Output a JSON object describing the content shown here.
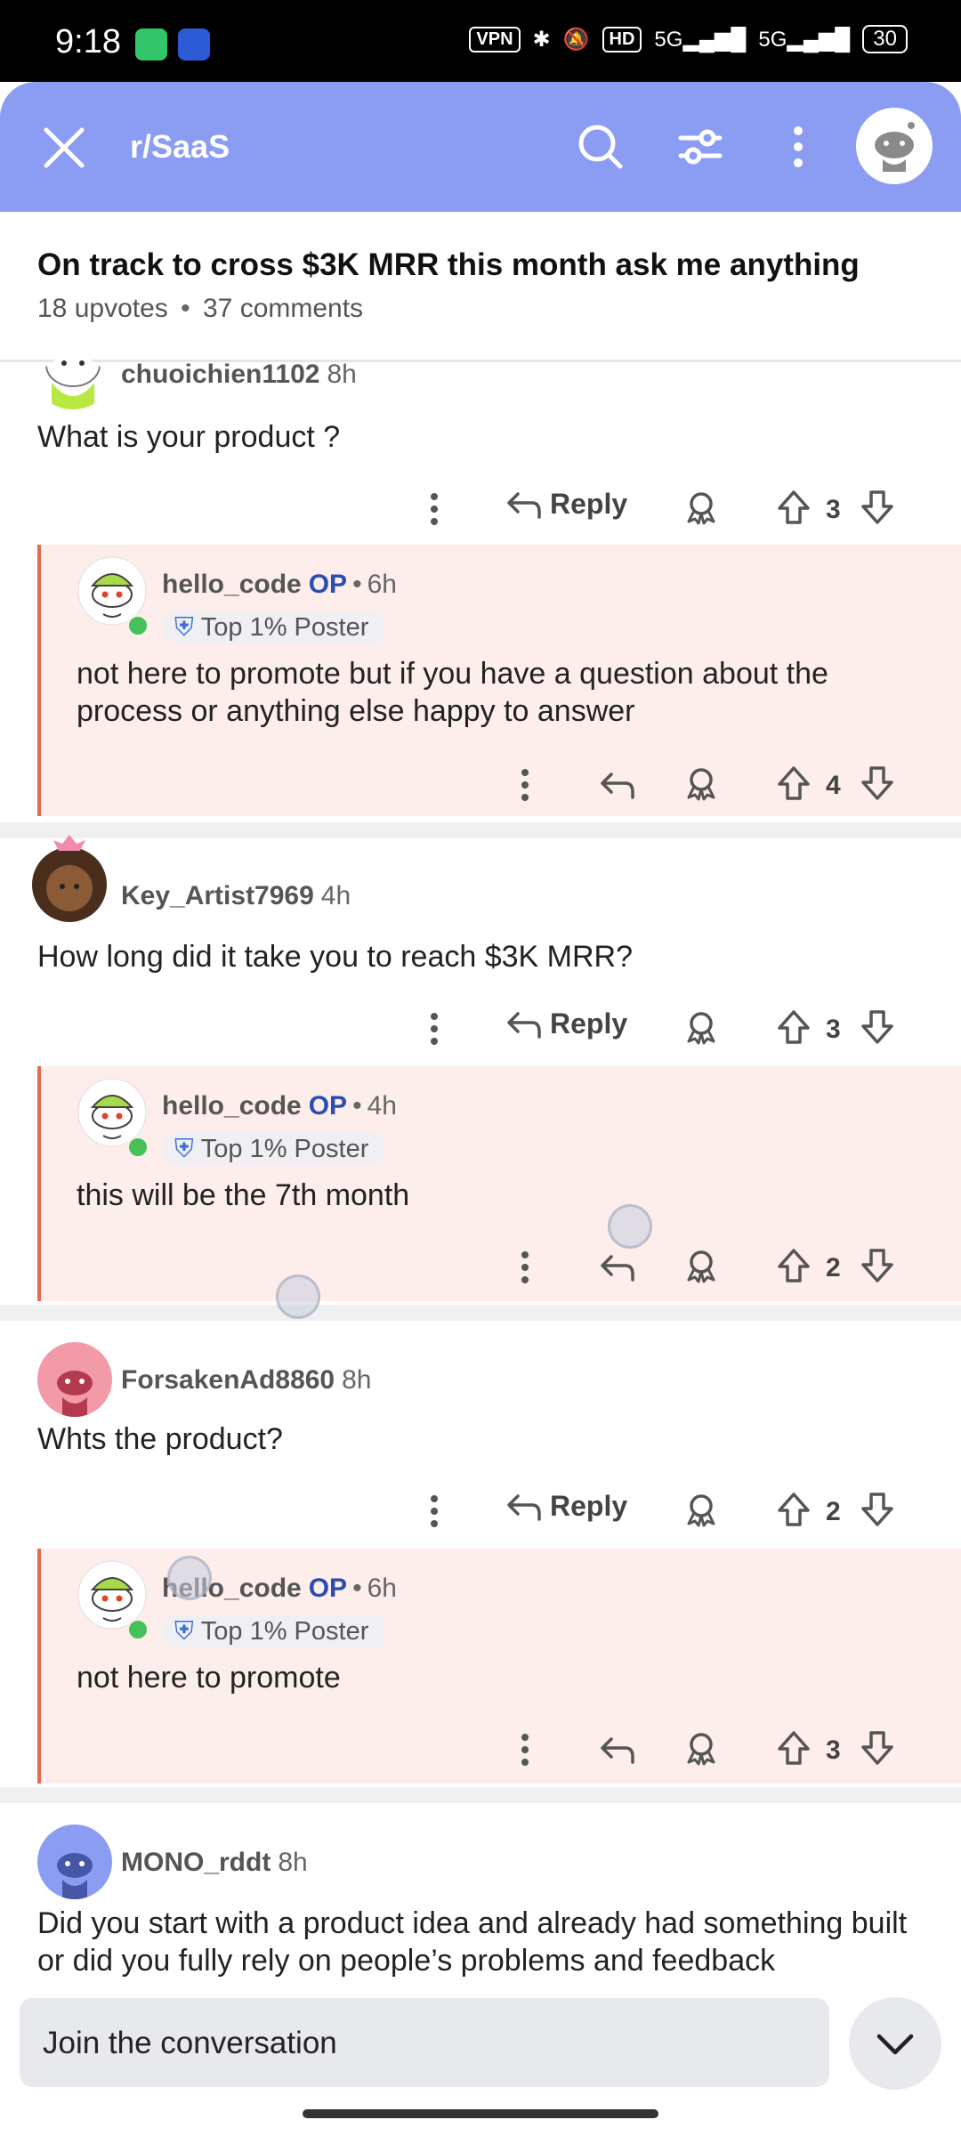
{
  "status_bar": {
    "time": "9:18",
    "vpn": "VPN",
    "hd": "HD",
    "net1": "5G",
    "net2": "5G",
    "battery": "30"
  },
  "header": {
    "subreddit": "r/SaaS"
  },
  "post": {
    "title": "On track to cross $3K MRR this month ask me anything",
    "upvotes": "18 upvotes",
    "comments": "37 comments"
  },
  "labels": {
    "reply": "Reply",
    "op": "OP",
    "flair": "Top 1% Poster",
    "sep": "•"
  },
  "threads": [
    {
      "user": "chuoichien1102",
      "time": "8h",
      "body": "What is your product ?",
      "votes": "3",
      "reply": {
        "user": "hello_code",
        "time": "6h",
        "body": "not here to promote but if you have a question about the process or anything else happy to answer",
        "votes": "4"
      }
    },
    {
      "user": "Key_Artist7969",
      "time": "4h",
      "body": "How long did it take you to reach $3K MRR?",
      "votes": "3",
      "reply": {
        "user": "hello_code",
        "time": "4h",
        "body": "this will be the 7th month",
        "votes": "2"
      }
    },
    {
      "user": "ForsakenAd8860",
      "time": "8h",
      "body": "Whts the product?",
      "votes": "2",
      "reply": {
        "user": "hello_code",
        "time": "6h",
        "body": "not here to promote",
        "votes": "3"
      }
    },
    {
      "user": "MONO_rddt",
      "time": "8h",
      "body": "Did you start with a product idea and already had something built or did you fully rely on people’s problems and feedback"
    }
  ],
  "composer": {
    "placeholder": "Join the conversation"
  },
  "colors": {
    "header": "#8b9cf3",
    "reply_bg": "#fdeeeb",
    "reply_border": "#e46a50",
    "op": "#2a4db3"
  },
  "icons": [
    "close-icon",
    "search-icon",
    "filter-icon",
    "more-vert-icon",
    "award-icon",
    "upvote-icon",
    "downvote-icon",
    "reply-arrow-icon",
    "chevron-down-icon"
  ]
}
